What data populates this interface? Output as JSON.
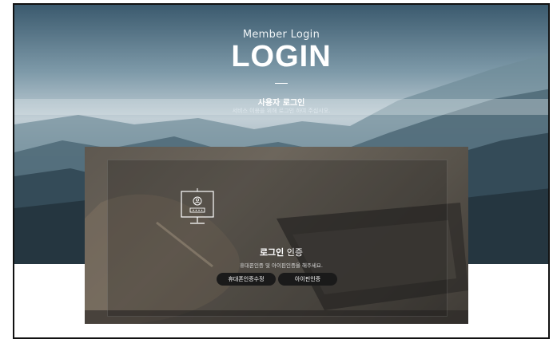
{
  "hero": {
    "subtitle": "Member Login",
    "title": "LOGIN",
    "heading": "사용자 로그인",
    "description": "서비스 이용을 위해 로그인 하여 주십시오."
  },
  "auth": {
    "title_strong": "로그인",
    "title_rest": " 인증",
    "description": "휴대폰인증 및 아이핀인증을 해주세요.",
    "phone_button": "휴대폰인증수정",
    "ipin_button": "아이핀인증",
    "icon": "monitor-user-icon"
  }
}
